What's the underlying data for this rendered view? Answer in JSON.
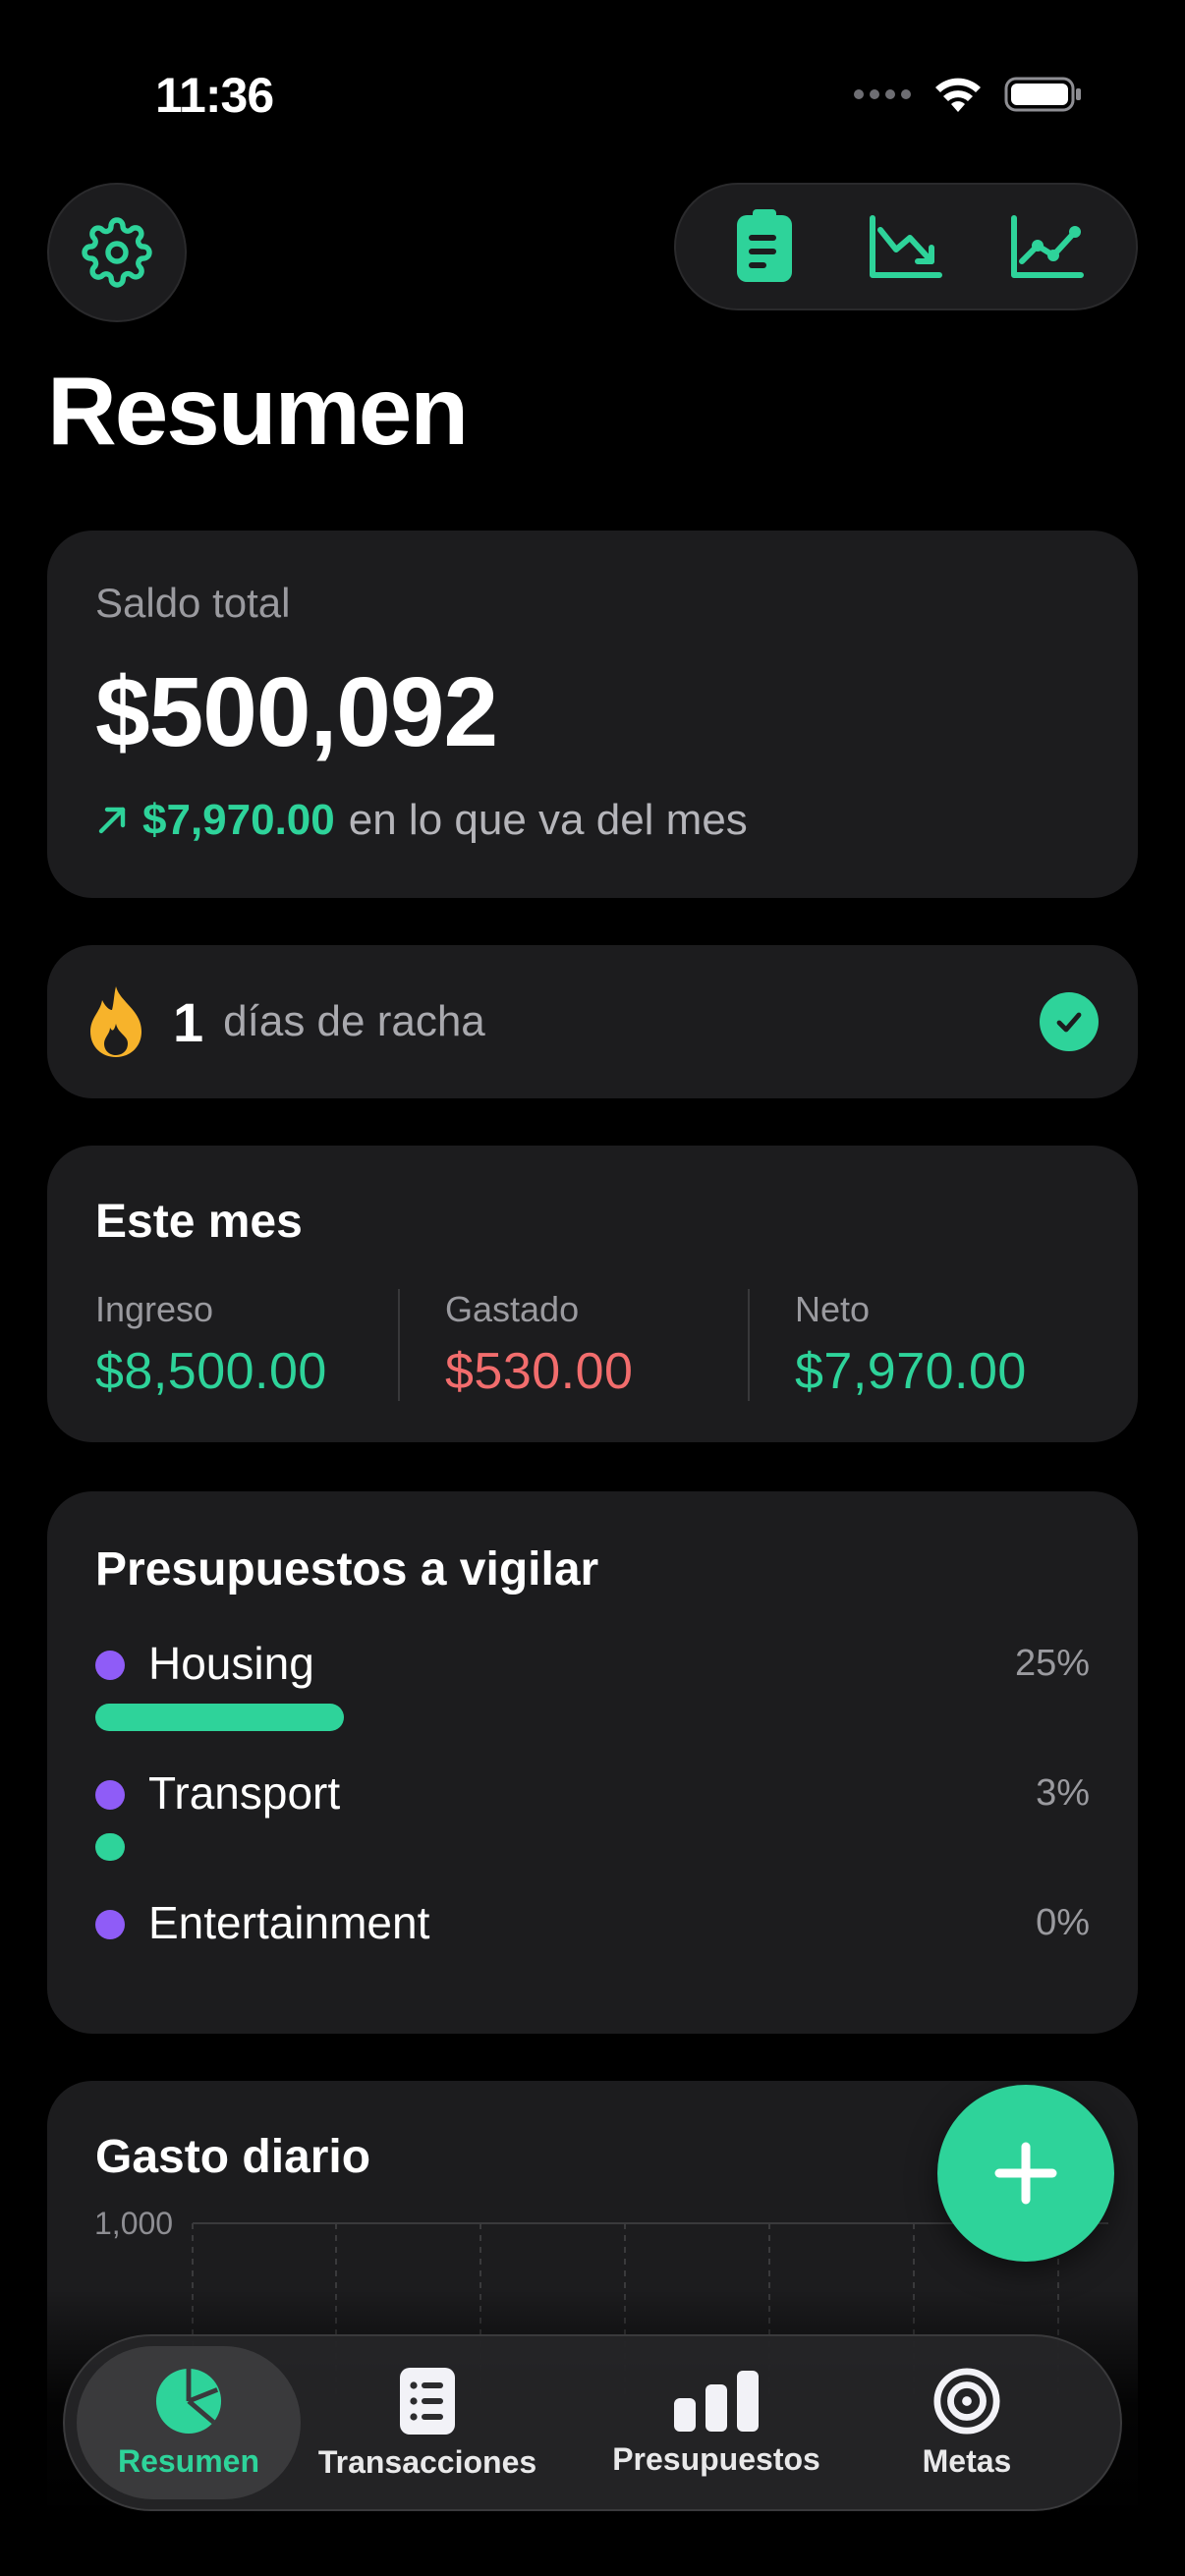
{
  "status_bar": {
    "time": "11:36"
  },
  "header": {
    "settings_icon": "gear-icon",
    "toolbar_icons": [
      "clipboard-icon",
      "trend-down-chart-icon",
      "trend-up-chart-icon"
    ],
    "title": "Resumen"
  },
  "balance": {
    "label": "Saldo total",
    "value": "$500,092",
    "delta_value": "$7,970.00",
    "delta_text": "en lo que va del mes"
  },
  "streak": {
    "count": "1",
    "text": "días de racha"
  },
  "month": {
    "title": "Este mes",
    "income_label": "Ingreso",
    "income_value": "$8,500.00",
    "spent_label": "Gastado",
    "spent_value": "$530.00",
    "net_label": "Neto",
    "net_value": "$7,970.00"
  },
  "budgets": {
    "title": "Presupuestos a vigilar",
    "items": [
      {
        "name": "Housing",
        "percent_label": "25%",
        "progress": 0.25
      },
      {
        "name": "Transport",
        "percent_label": "3%",
        "progress": 0.03
      },
      {
        "name": "Entertainment",
        "percent_label": "0%",
        "progress": 0.0
      }
    ]
  },
  "daily": {
    "title": "Gasto diario",
    "y_tick_top": "1,000"
  },
  "chart_data": {
    "type": "bar",
    "title": "Gasto diario",
    "ylim": [
      0,
      1000
    ],
    "y_ticks": [
      "1,000"
    ],
    "grid": true
  },
  "fab": {
    "icon": "plus-icon"
  },
  "tabbar": {
    "tabs": [
      {
        "label": "Resumen",
        "icon": "pie-chart-icon",
        "active": true
      },
      {
        "label": "Transacciones",
        "icon": "list-icon",
        "active": false
      },
      {
        "label": "Presupuestos",
        "icon": "bar-chart-icon",
        "active": false
      },
      {
        "label": "Metas",
        "icon": "target-icon",
        "active": false
      }
    ]
  },
  "colors": {
    "accent": "#2ed39a",
    "negative": "#f26d6d",
    "budget_dot": "#8f5cf7",
    "card": "#1c1c1e",
    "background": "#000000"
  }
}
